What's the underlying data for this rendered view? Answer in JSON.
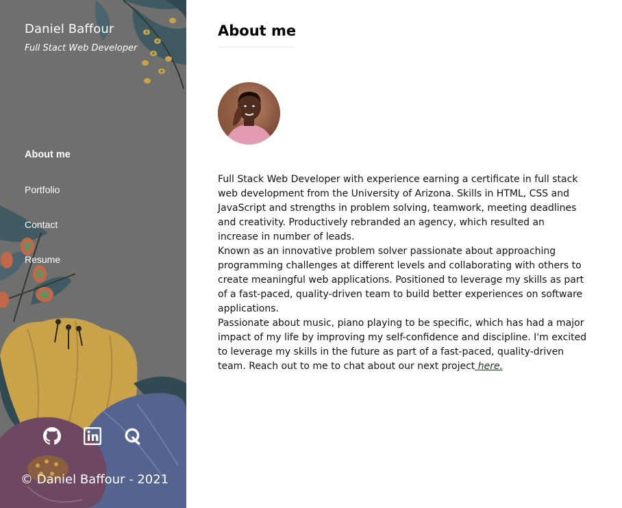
{
  "sidebar": {
    "name": "Daniel Baffour",
    "role": "Full Stact Web Developer",
    "nav": [
      {
        "label": "About me",
        "active": true
      },
      {
        "label": "Portfolio",
        "active": false
      },
      {
        "label": "Contact",
        "active": false
      },
      {
        "label": "Resume",
        "active": false
      }
    ],
    "social": [
      "github-icon",
      "linkedin-icon",
      "quora-icon"
    ],
    "copyright": "© Daniel Baffour - 2021"
  },
  "main": {
    "title": "About me",
    "bio": {
      "p1": "Full Stack Web Developer with experience earning a certificate in full stack web development from the University of Arizona. Skills in HTML, CSS and JavaScript and strengths in problem solving, teamwork, meeting deadlines and creativity. Productively rebranded an agency, which resulted an increase in number of leads.",
      "p2": "Known as an innovative problem solver passionate about approaching programming challenges at different levels and collaborating with others to create meaningful web applications. Positioned to leverage my skills as part of a fast-paced, quality-driven team to build better experiences on software applications.",
      "p3": "Passionate about music, piano playing to be specific, which has had a major impact of my life by improving my self-confidence and discipline. I'm excited to leverage my skills in the future as part of a fast-paced, quality-driven team. Reach out to me to chat about our next project",
      "link": " here."
    }
  },
  "colors": {
    "sidebar_bg": "#6f6f6d",
    "link": "#1a3a1a",
    "flower_yellow": "#c9a24a",
    "flower_blue": "#55648f",
    "flower_mauve": "#6d4860",
    "leaf_teal": "#3f5a63"
  }
}
